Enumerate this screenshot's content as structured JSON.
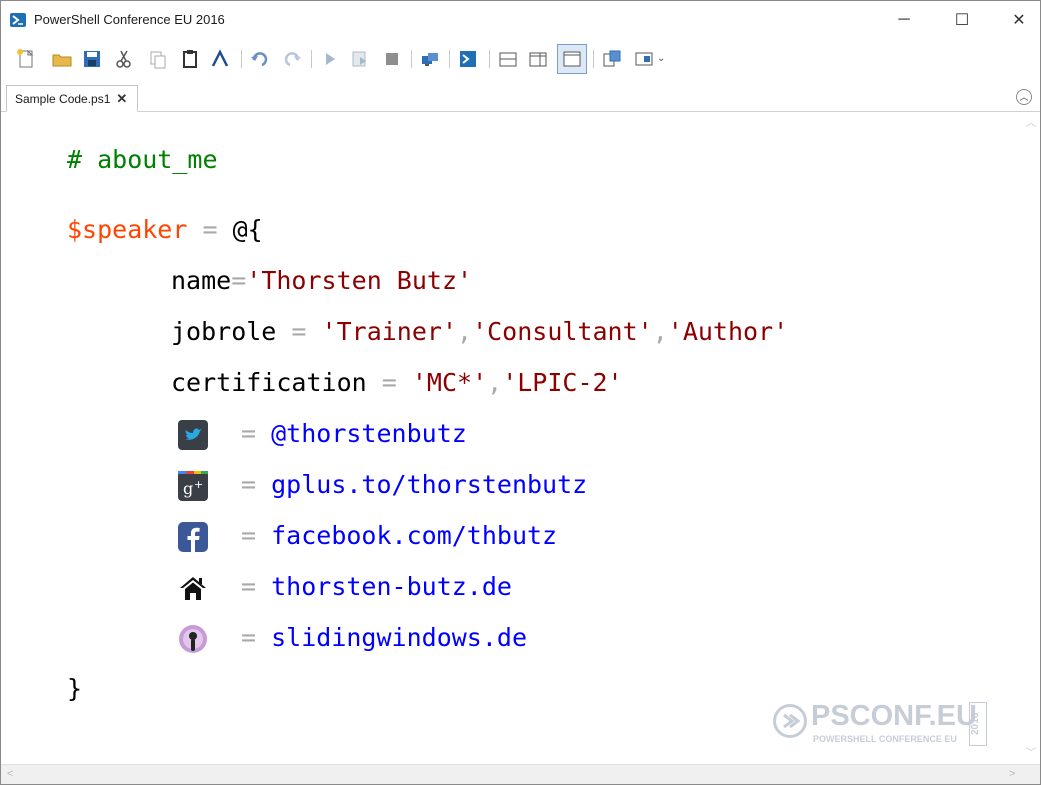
{
  "window": {
    "title": "PowerShell Conference EU 2016",
    "minimize": "─",
    "maximize": "☐",
    "close": "✕"
  },
  "toolbar": {
    "icons": [
      "new-file-icon",
      "open-folder-icon",
      "save-icon",
      "cut-icon",
      "copy-icon",
      "paste-icon",
      "powershell-prompt-icon",
      "undo-icon",
      "redo-icon",
      "run-icon",
      "run-selection-icon",
      "stop-icon",
      "remote-powershell-icon",
      "powershell-console-icon",
      "show-script-pane-top-icon",
      "show-script-pane-right-icon",
      "show-script-pane-maximized-icon",
      "show-command-window-icon",
      "show-command-addon-icon",
      "toolbar-overflow-icon"
    ]
  },
  "tab": {
    "label": "Sample Code.ps1",
    "close": "✕"
  },
  "code": {
    "comment": "# about_me",
    "var_name": "$speaker",
    "eq": "=",
    "open": "@{",
    "name_key": "name",
    "name_val": "'Thorsten Butz'",
    "jobrole_key": "jobrole",
    "jobrole_v1": "'Trainer'",
    "jobrole_v2": "'Consultant'",
    "jobrole_v3": "'Author'",
    "comma": ",",
    "cert_key": "certification",
    "cert_v1": "'MC*'",
    "cert_v2": "'LPIC-2'",
    "twitter": "@thorstenbutz",
    "gplus": "gplus.to/thorstenbutz",
    "facebook": "facebook.com/thbutz",
    "home": "thorsten-butz.de",
    "podcast": "slidingwindows.de",
    "close": "}"
  },
  "logo": {
    "main": "PSCONF.EU",
    "sub": "POWERSHELL CONFERENCE EU",
    "year": "2016"
  },
  "colors": {
    "comment": "#008000",
    "variable": "#ff4500",
    "string": "#8b0000",
    "link": "#0000ff",
    "operator": "#a9a9a9"
  }
}
